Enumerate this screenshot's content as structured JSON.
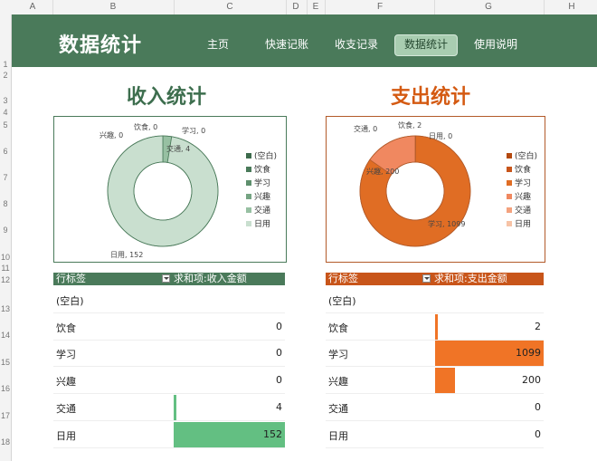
{
  "sheet": {
    "columns": [
      "A",
      "B",
      "C",
      "D",
      "E",
      "F",
      "G",
      "H"
    ],
    "rows": [
      "1",
      "2",
      "3",
      "4",
      "5",
      "6",
      "7",
      "8",
      "9",
      "10",
      "11",
      "12",
      "13",
      "14",
      "15",
      "16",
      "17",
      "18"
    ]
  },
  "banner": {
    "title": "数据统计",
    "nav": [
      "主页",
      "快速记账",
      "收支记录",
      "数据统计",
      "使用说明"
    ],
    "active_index": 3
  },
  "income": {
    "title": "收入统计",
    "table_header_label": "行标签",
    "table_header_value": "求和项:收入金额",
    "chart_data": {
      "type": "pie",
      "categories": [
        "(空白)",
        "饮食",
        "学习",
        "兴趣",
        "交通",
        "日用"
      ],
      "values": [
        0,
        0,
        0,
        0,
        4,
        152
      ],
      "data_labels": [
        "",
        "饮食, 0",
        "学习, 0",
        "兴趣, 0",
        "交通, 4",
        "日用, 152"
      ],
      "legend_position": "right",
      "colors": [
        "#3d6b4c",
        "#4a7a5a",
        "#5e8f6d",
        "#75a483",
        "#97c0a2",
        "#c9dfcf"
      ]
    },
    "rows": [
      {
        "label": "(空白)",
        "value": ""
      },
      {
        "label": "饮食",
        "value": "0"
      },
      {
        "label": "学习",
        "value": "0"
      },
      {
        "label": "兴趣",
        "value": "0"
      },
      {
        "label": "交通",
        "value": "4"
      },
      {
        "label": "日用",
        "value": "152"
      }
    ],
    "bar_color": "#63bf82",
    "line_color": "#4a7a5a"
  },
  "expense": {
    "title": "支出统计",
    "table_header_label": "行标签",
    "table_header_value": "求和项:支出金额",
    "chart_data": {
      "type": "pie",
      "categories": [
        "(空白)",
        "饮食",
        "学习",
        "兴趣",
        "交通",
        "日用"
      ],
      "values": [
        0,
        2,
        1099,
        200,
        0,
        0
      ],
      "data_labels": [
        "",
        "饮食, 2",
        "学习, 1099",
        "兴趣, 200",
        "交通, 0",
        "日用, 0"
      ],
      "legend_position": "right",
      "colors": [
        "#b4490f",
        "#c8551a",
        "#e06d24",
        "#f08860",
        "#f4a27e",
        "#f7c3a6"
      ]
    },
    "rows": [
      {
        "label": "(空白)",
        "value": ""
      },
      {
        "label": "饮食",
        "value": "2"
      },
      {
        "label": "学习",
        "value": "1099"
      },
      {
        "label": "兴趣",
        "value": "200"
      },
      {
        "label": "交通",
        "value": "0"
      },
      {
        "label": "日用",
        "value": "0"
      }
    ],
    "bar_color": "#f07426",
    "line_color": "#b35b2a"
  }
}
